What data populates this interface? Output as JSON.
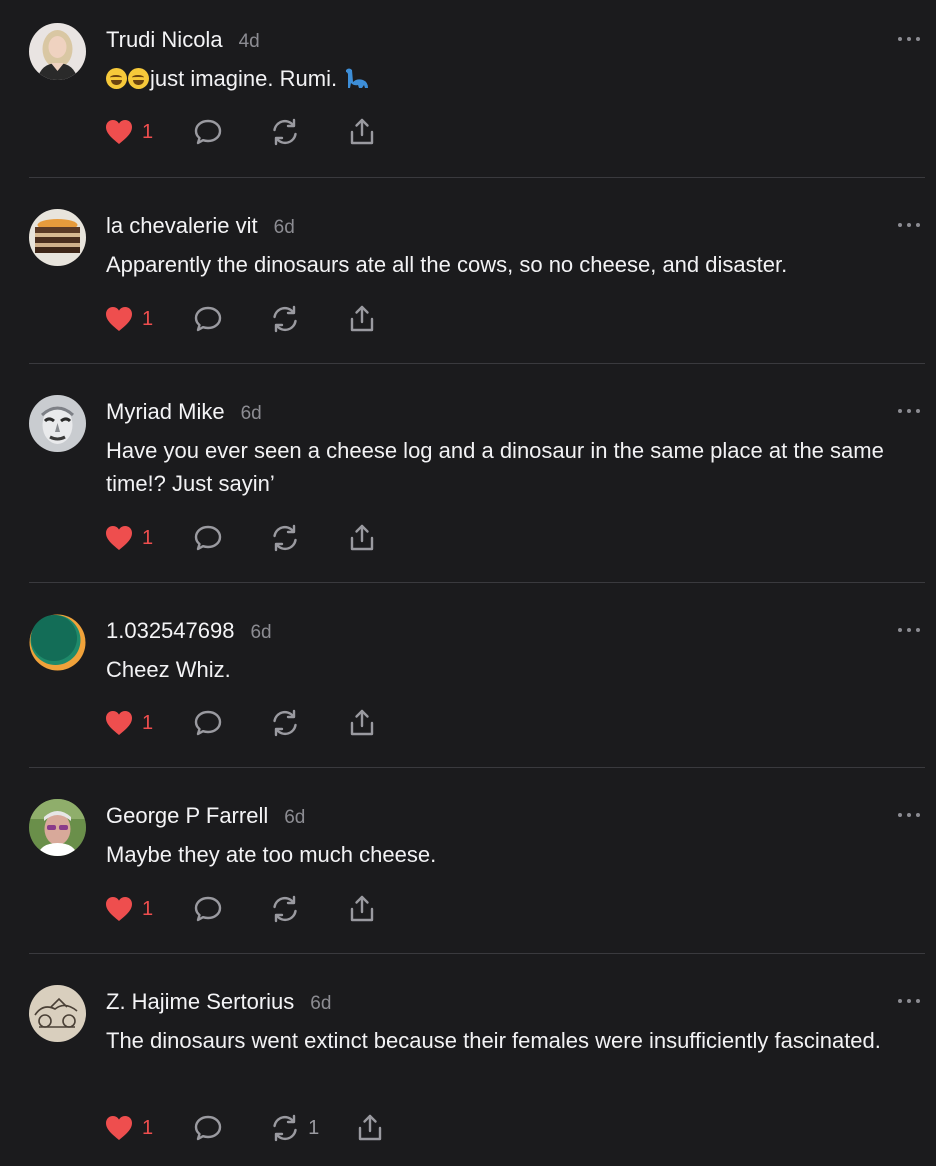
{
  "colors": {
    "background": "#1b1b1d",
    "text": "#f2f2f4",
    "muted": "#8c8c92",
    "like": "#ee4e4e",
    "divider": "#3a3a3e"
  },
  "icons": {
    "like": "heart-icon",
    "reply": "speech-bubble-icon",
    "restack": "restack-arrows-icon",
    "share": "share-upload-icon",
    "more": "more-dots-icon"
  },
  "comments": [
    {
      "author": "Trudi Nicola",
      "time": "4d",
      "emoji": "🤣🤣",
      "text": "just imagine. Rumi. ",
      "trailing_emoji": "🦕",
      "likes": "1",
      "restacks": ""
    },
    {
      "author": "la chevalerie vit",
      "time": "6d",
      "text": "Apparently the dinosaurs ate all the cows, so no cheese, and disaster.",
      "likes": "1",
      "restacks": ""
    },
    {
      "author": "Myriad Mike",
      "time": "6d",
      "text": "Have you ever seen a cheese log and a dinosaur in the same place at the same time!? Just sayin’",
      "likes": "1",
      "restacks": ""
    },
    {
      "author": "1.032547698",
      "time": "6d",
      "text": "Cheez Whiz.",
      "likes": "1",
      "restacks": ""
    },
    {
      "author": "George P Farrell",
      "time": "6d",
      "text": "Maybe they ate too much cheese.",
      "likes": "1",
      "restacks": ""
    },
    {
      "author": "Z. Hajime Sertorius",
      "time": "6d",
      "text": "The dinosaurs went extinct because their females were insufficiently fascinated.",
      "likes": "1",
      "restacks": "1"
    }
  ]
}
